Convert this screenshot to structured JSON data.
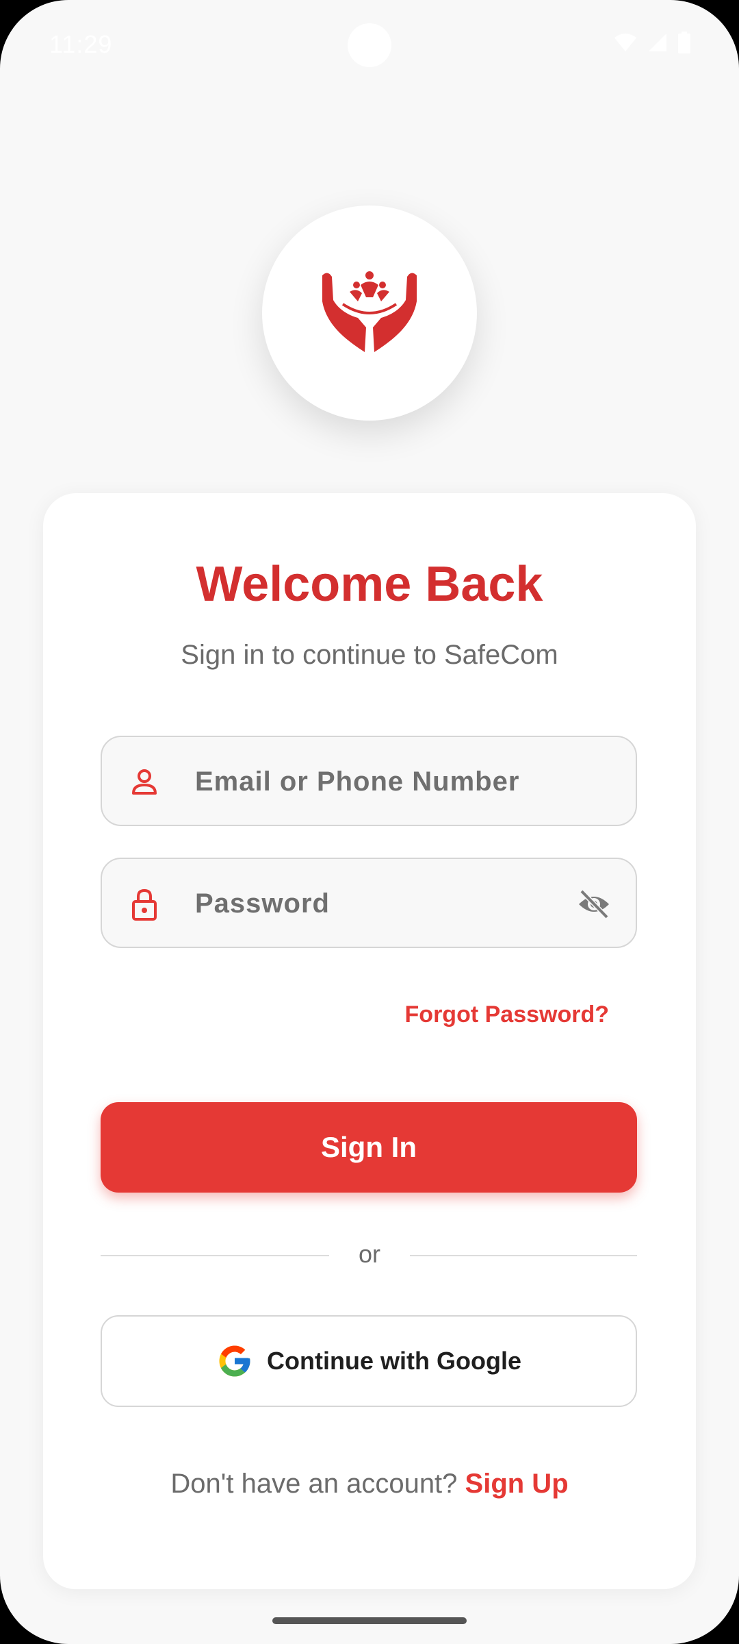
{
  "status_bar": {
    "time": "11:29"
  },
  "icons": {
    "logo": "helping-hands-logo-icon",
    "user": "person-icon",
    "lock": "lock-icon",
    "visibility": "eye-off-icon",
    "google": "google-logo-icon"
  },
  "colors": {
    "accent": "#e53935",
    "title": "#d32f2f",
    "background": "#f8f8f8",
    "card": "#ffffff"
  },
  "login": {
    "title": "Welcome Back",
    "subtitle": "Sign in to continue to SafeCom",
    "email_placeholder": "Email or Phone Number",
    "email_value": "",
    "password_placeholder": "Password",
    "password_value": "",
    "forgot_label": "Forgot Password?",
    "signin_label": "Sign In",
    "divider_label": "or",
    "google_label": "Continue with Google",
    "signup_prompt": "Don't have an account? ",
    "signup_link": "Sign Up"
  }
}
